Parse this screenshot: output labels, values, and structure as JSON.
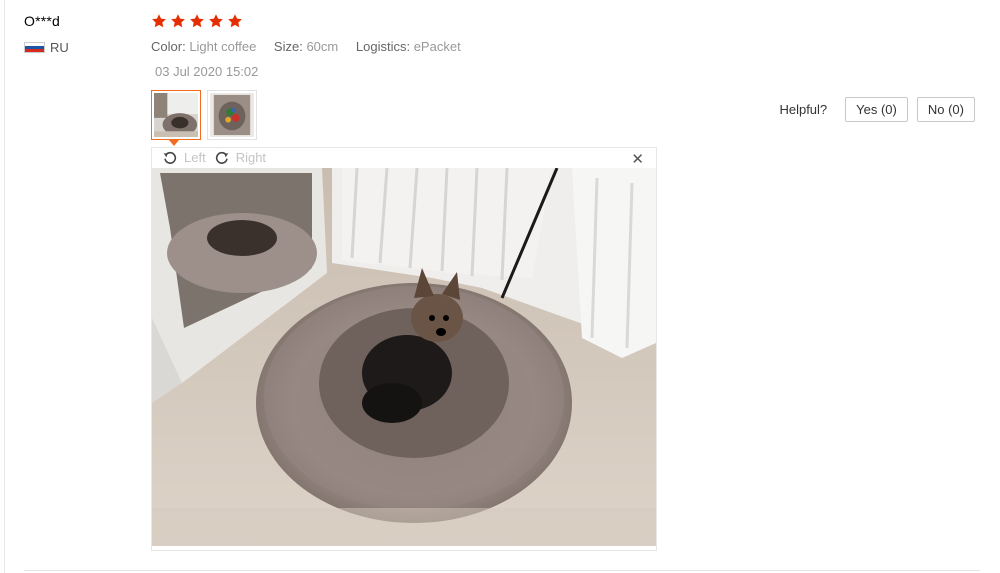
{
  "review": {
    "user": "O***d",
    "country": "RU",
    "rating": 5,
    "rating_max": 5,
    "star_color": "#e62e04",
    "attributes": [
      {
        "key": "Color:",
        "value": "Light coffee"
      },
      {
        "key": "Size:",
        "value": "60cm"
      },
      {
        "key": "Logistics:",
        "value": "ePacket"
      }
    ],
    "date": "03 Jul 2020 15:02",
    "thumbnail_count": 2,
    "active_thumbnail": 1,
    "accent_color": "#f26d21"
  },
  "helpful": {
    "label": "Helpful?",
    "yes": "Yes (0)",
    "no": "No (0)"
  },
  "viewer": {
    "rotate_left": "Left",
    "rotate_right": "Right",
    "close_icon": "close-icon"
  }
}
